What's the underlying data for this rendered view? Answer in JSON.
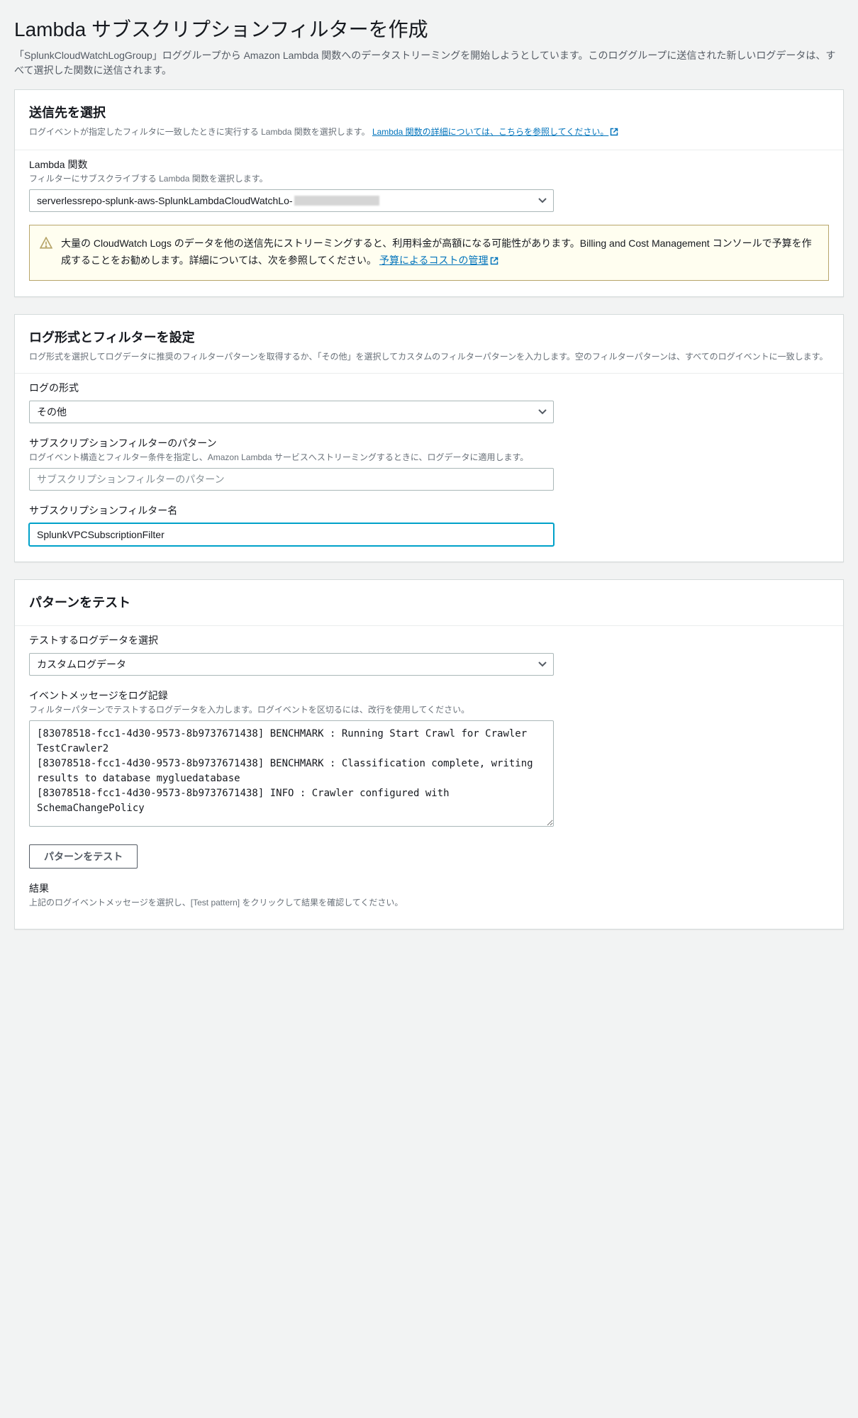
{
  "header": {
    "title": "Lambda サブスクリプションフィルターを作成",
    "description": "「SplunkCloudWatchLogGroup」ロググループから Amazon Lambda 関数へのデータストリーミングを開始しようとしています。このロググループに送信された新しいログデータは、すべて選択した関数に送信されます。"
  },
  "section_destination": {
    "title": "送信先を選択",
    "desc_prefix": "ログイベントが指定したフィルタに一致したときに実行する Lambda 関数を選択します。 ",
    "link_text": "Lambda 関数の詳細については、こちらを参照してください。",
    "lambda_label": "Lambda 関数",
    "lambda_hint": "フィルターにサブスクライブする Lambda 関数を選択します。",
    "lambda_selected": "serverlessrepo-splunk-aws-SplunkLambdaCloudWatchLo-",
    "alert_text_1": "大量の CloudWatch Logs のデータを他の送信先にストリーミングすると、利用料金が高額になる可能性があります。Billing and Cost Management コンソールで予算を作成することをお勧めします。詳細については、次を参照してください。 ",
    "alert_link": "予算によるコストの管理"
  },
  "section_filter": {
    "title": "ログ形式とフィルターを設定",
    "desc": "ログ形式を選択してログデータに推奨のフィルターパターンを取得するか、「その他」を選択してカスタムのフィルターパターンを入力します。空のフィルターパターンは、すべてのログイベントに一致します。",
    "format_label": "ログの形式",
    "format_selected": "その他",
    "pattern_label": "サブスクリプションフィルターのパターン",
    "pattern_hint": "ログイベント構造とフィルター条件を指定し、Amazon Lambda サービスへストリーミングするときに、ログデータに適用します。",
    "pattern_placeholder": "サブスクリプションフィルターのパターン",
    "name_label": "サブスクリプションフィルター名",
    "name_value": "SplunkVPCSubscriptionFilter"
  },
  "section_test": {
    "title": "パターンをテスト",
    "select_label": "テストするログデータを選択",
    "select_value": "カスタムログデータ",
    "events_label": "イベントメッセージをログ記録",
    "events_hint": "フィルターパターンでテストするログデータを入力します。ログイベントを区切るには、改行を使用してください。",
    "events_value": "[83078518-fcc1-4d30-9573-8b9737671438] BENCHMARK : Running Start Crawl for Crawler TestCrawler2\n[83078518-fcc1-4d30-9573-8b9737671438] BENCHMARK : Classification complete, writing results to database mygluedatabase\n[83078518-fcc1-4d30-9573-8b9737671438] INFO : Crawler configured with SchemaChangePolicy",
    "test_button": "パターンをテスト",
    "results_label": "結果",
    "results_hint": "上記のログイベントメッセージを選択し、[Test pattern] をクリックして結果を確認してください。"
  }
}
